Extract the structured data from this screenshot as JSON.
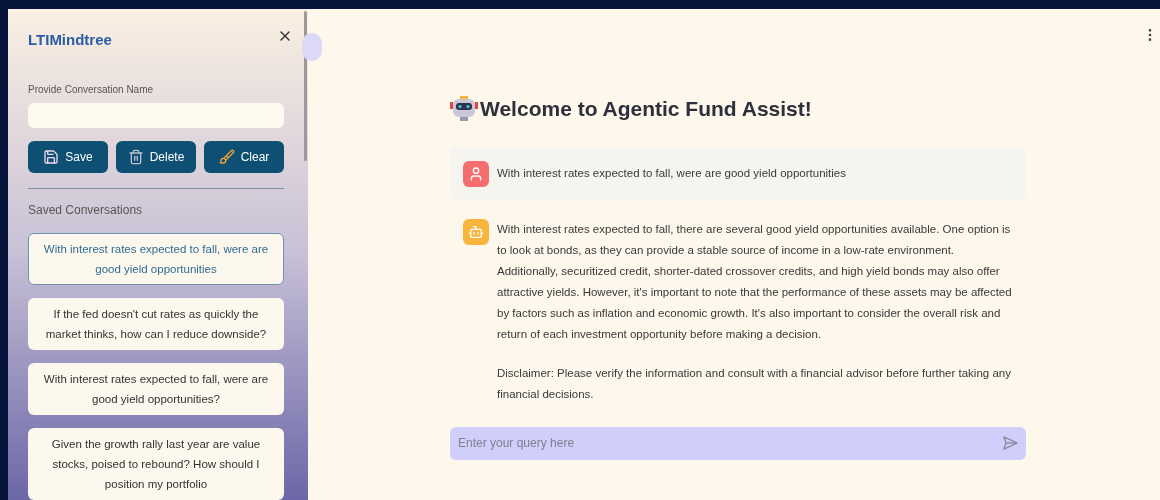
{
  "sidebar": {
    "logo": "LTIMindtree",
    "name_field": {
      "label": "Provide Conversation Name"
    },
    "buttons": [
      {
        "kind": "save",
        "label": "Save"
      },
      {
        "kind": "delete",
        "label": "Delete"
      },
      {
        "kind": "clear",
        "label": "Clear"
      }
    ],
    "saved_heading": "Saved Conversations",
    "conversations": [
      {
        "text": "With interest rates expected to fall, were are good yield opportunities",
        "selected": true
      },
      {
        "text": "If the fed doesn't cut rates as quickly the market thinks, how can I reduce downside?",
        "selected": false
      },
      {
        "text": "With interest rates expected to fall, were are good yield opportunities?",
        "selected": false
      },
      {
        "text": "Given the growth rally last year are value stocks, poised to rebound? How should I position my portfolio",
        "selected": false
      }
    ]
  },
  "main": {
    "title": "Welcome to Agentic Fund Assist!",
    "messages": [
      {
        "kind": "user",
        "paragraphs": [
          "With interest rates expected to fall, were are good yield opportunities"
        ]
      },
      {
        "kind": "assistant",
        "paragraphs": [
          "With interest rates expected to fall, there are several good yield opportunities available. One option is to look at bonds, as they can provide a stable source of income in a low-rate environment. Additionally, securitized credit, shorter-dated crossover credits, and high yield bonds may also offer attractive yields. However, it's important to note that the performance of these assets may be affected by factors such as inflation and economic growth. It's also important to consider the overall risk and return of each investment opportunity before making a decision.",
          "Disclaimer: Please verify the information and consult with a financial advisor before further taking any financial decisions."
        ]
      }
    ],
    "query": {
      "placeholder": "Enter your query here"
    }
  }
}
